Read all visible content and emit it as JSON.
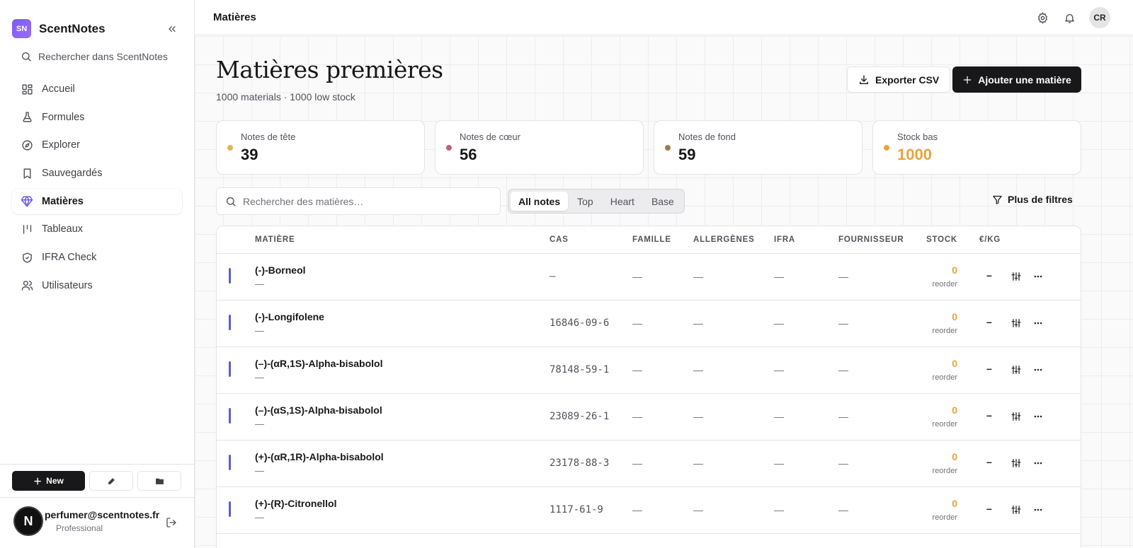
{
  "brand": {
    "initials": "SN",
    "name": "ScentNotes"
  },
  "sidebar": {
    "search_label": "Rechercher dans ScentNotes",
    "items": [
      {
        "label": "Accueil",
        "icon": "dashboard-icon"
      },
      {
        "label": "Formules",
        "icon": "flask-icon"
      },
      {
        "label": "Explorer",
        "icon": "compass-icon"
      },
      {
        "label": "Sauvegardés",
        "icon": "bookmark-icon"
      },
      {
        "label": "Matières",
        "icon": "gem-icon",
        "active": true
      },
      {
        "label": "Tableaux",
        "icon": "columns-icon"
      },
      {
        "label": "IFRA Check",
        "icon": "shield-check-icon"
      },
      {
        "label": "Utilisateurs",
        "icon": "users-icon"
      }
    ],
    "new_label": "New",
    "user": {
      "avatar_letter": "N",
      "email": "perfumer@scentnotes.fr",
      "plan": "Professional"
    }
  },
  "topbar": {
    "title": "Matières",
    "avatar": "CR"
  },
  "page": {
    "title": "Matières premières",
    "subtitle": "1000 materials · 1000 low stock",
    "export_label": "Exporter CSV",
    "add_label": "Ajouter une matière"
  },
  "stats": [
    {
      "label": "Notes de tête",
      "value": "39",
      "dot_color": "#e0b25a",
      "value_color": "#18181b"
    },
    {
      "label": "Notes de cœur",
      "value": "56",
      "dot_color": "#c4607a",
      "value_color": "#18181b"
    },
    {
      "label": "Notes de fond",
      "value": "59",
      "dot_color": "#9c7a50",
      "value_color": "#18181b"
    },
    {
      "label": "Stock bas",
      "value": "1000",
      "dot_color": "#e8a33a",
      "value_color": "#e8a33a"
    }
  ],
  "filters": {
    "search_placeholder": "Rechercher des matières…",
    "segments": [
      "All notes",
      "Top",
      "Heart",
      "Base"
    ],
    "active_segment": "All notes",
    "more_label": "Plus de filtres"
  },
  "table": {
    "columns": [
      "MATIÈRE",
      "CAS",
      "FAMILLE",
      "ALLERGÈNES",
      "IFRA",
      "FOURNISSEUR",
      "STOCK",
      "€/KG"
    ],
    "rows": [
      {
        "name": "(-)-Borneol",
        "sub": "—",
        "cas": "—",
        "famille": "—",
        "allergenes": "—",
        "ifra": "—",
        "fournisseur": "—",
        "stock": "0",
        "stock_sub": "reorder",
        "price": "–"
      },
      {
        "name": "(-)-Longifolene",
        "sub": "—",
        "cas": "16846-09-6",
        "famille": "—",
        "allergenes": "—",
        "ifra": "—",
        "fournisseur": "—",
        "stock": "0",
        "stock_sub": "reorder",
        "price": "–"
      },
      {
        "name": "(–)-(αR,1S)-Alpha-bisabolol",
        "sub": "—",
        "cas": "78148-59-1",
        "famille": "—",
        "allergenes": "—",
        "ifra": "—",
        "fournisseur": "—",
        "stock": "0",
        "stock_sub": "reorder",
        "price": "–"
      },
      {
        "name": "(–)-(αS,1S)-Alpha-bisabolol",
        "sub": "—",
        "cas": "23089-26-1",
        "famille": "—",
        "allergenes": "—",
        "ifra": "—",
        "fournisseur": "—",
        "stock": "0",
        "stock_sub": "reorder",
        "price": "–"
      },
      {
        "name": "(+)-(αR,1R)-Alpha-bisabolol",
        "sub": "—",
        "cas": "23178-88-3",
        "famille": "—",
        "allergenes": "—",
        "ifra": "—",
        "fournisseur": "—",
        "stock": "0",
        "stock_sub": "reorder",
        "price": "–"
      },
      {
        "name": "(+)-(R)-Citronellol",
        "sub": "—",
        "cas": "1117-61-9",
        "famille": "—",
        "allergenes": "—",
        "ifra": "—",
        "fournisseur": "—",
        "stock": "0",
        "stock_sub": "reorder",
        "price": "–"
      }
    ]
  }
}
